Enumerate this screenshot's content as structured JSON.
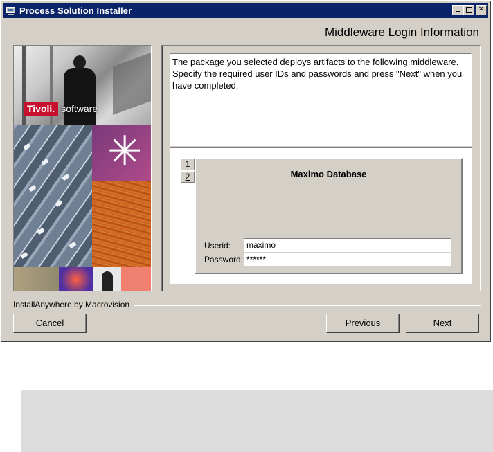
{
  "window": {
    "title": "Process Solution Installer"
  },
  "header": {
    "title": "Middleware Login Information"
  },
  "branding": {
    "logo_red": "Tivoli.",
    "logo_text": "software"
  },
  "description": {
    "text": "The package you selected deploys artifacts to the following middleware. Specify the required user IDs and passwords and press \"Next\" when you have completed."
  },
  "tabs": [
    "1",
    "2"
  ],
  "db_panel": {
    "title": "Maximo Database",
    "userid_label": "Userid:",
    "userid_value": "maximo",
    "password_label": "Password:",
    "password_value": "******"
  },
  "footer": {
    "vendor": "InstallAnywhere by Macrovision"
  },
  "buttons": {
    "cancel_u": "C",
    "cancel_rest": "ancel",
    "previous_u": "P",
    "previous_rest": "revious",
    "next_u": "N",
    "next_rest": "ext"
  },
  "colors": {
    "titlebar": "#0a246a",
    "window_bg": "#d4d0c8",
    "logo_red": "#c8102e"
  },
  "icons": [
    "app-window-icon",
    "minimize-icon",
    "maximize-icon",
    "close-icon"
  ]
}
